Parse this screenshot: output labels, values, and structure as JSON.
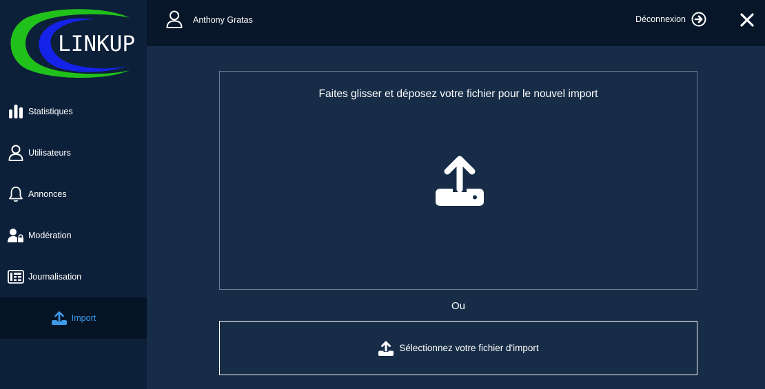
{
  "brand": {
    "logo_text": "LINKUP",
    "colors": {
      "green": "#21c11b",
      "blue": "#1522e8"
    }
  },
  "sidebar": {
    "items": [
      {
        "label": "Statistiques",
        "icon": "bar-chart-icon"
      },
      {
        "label": "Utilisateurs",
        "icon": "user-icon"
      },
      {
        "label": "Annonces",
        "icon": "bell-icon"
      },
      {
        "label": "Modération",
        "icon": "user-lock-icon"
      },
      {
        "label": "Journalisation",
        "icon": "log-icon"
      },
      {
        "label": "Import",
        "icon": "upload-icon",
        "active": true
      }
    ]
  },
  "header": {
    "user_name": "Anthony Gratas",
    "logout_label": "Déconnexion",
    "close_icon": "close-icon"
  },
  "main": {
    "dropzone_text": "Faites glisser et déposez votre fichier pour le nouvel import",
    "or_text": "Ou",
    "select_button_label": "Sélectionnez votre fichier d'import"
  },
  "theme": {
    "background": "#172c47",
    "sidebar": "#0d2039",
    "header": "#071628",
    "active_item_bg": "#061526",
    "active_item_text": "#3d9be9"
  }
}
